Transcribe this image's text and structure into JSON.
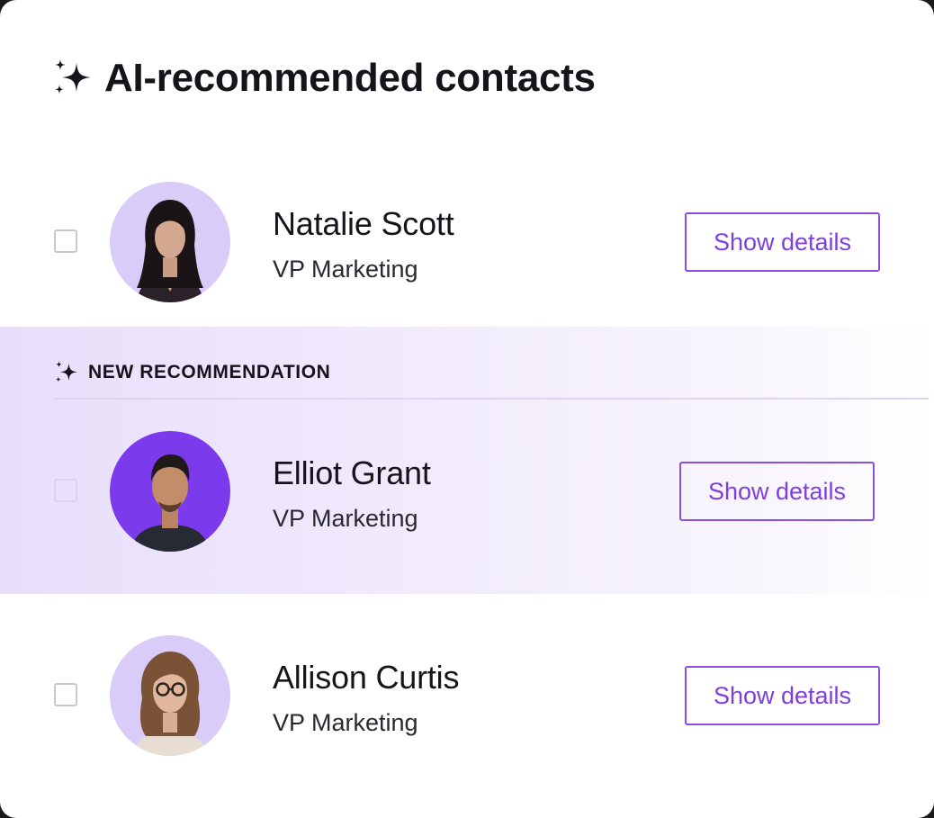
{
  "header": {
    "title": "AI-recommended contacts",
    "icon": "sparkles-icon"
  },
  "recommendation_label": "NEW RECOMMENDATION",
  "contacts": [
    {
      "name": "Natalie Scott",
      "role": "VP Marketing",
      "button": "Show details",
      "avatar_bg": "#d9ccf8"
    },
    {
      "name": "Elliot Grant",
      "role": "VP Marketing",
      "button": "Show details",
      "avatar_bg": "#7c3aed"
    },
    {
      "name": "Allison Curtis",
      "role": "VP Marketing",
      "button": "Show details",
      "avatar_bg": "#d9ccf8"
    }
  ],
  "colors": {
    "accent": "#7e3fe0",
    "highlight": "#e8defb",
    "text": "#16141a"
  }
}
